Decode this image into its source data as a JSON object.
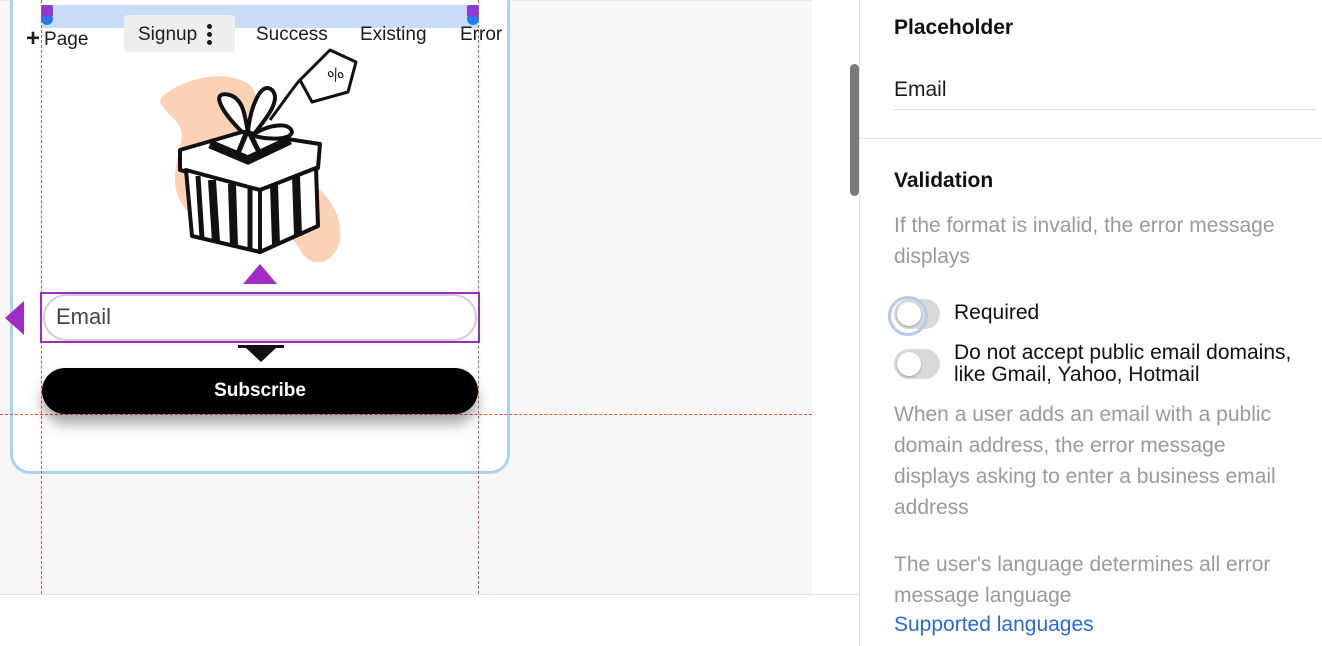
{
  "canvas": {
    "email_placeholder": "Email",
    "subscribe_label": "Subscribe"
  },
  "page_tabs": {
    "add_label": "Page",
    "add_icon": "plus-icon",
    "items": [
      "Signup",
      "Success",
      "Existing",
      "Error"
    ],
    "active": "Signup"
  },
  "settings": {
    "placeholder": {
      "title": "Placeholder",
      "value": "Email"
    },
    "validation": {
      "title": "Validation",
      "description": "If the format is invalid, the error message displays",
      "required_label": "Required",
      "required_on": false,
      "public_domains_label": "Do not accept public email domains, like Gmail, Yahoo, Hotmail",
      "public_domains_on": false,
      "public_domains_description": "When a user adds an email with a public domain address, the error message displays asking to enter a business email address",
      "language_description": "The user's language determines all error message language",
      "supported_languages_link": "Supported languages"
    }
  },
  "colors": {
    "selection": "#9c2fb8",
    "frame_border": "#a9d3f2",
    "button_bg": "#000000",
    "link": "#2b6bd1",
    "guide": "#e0533e"
  }
}
